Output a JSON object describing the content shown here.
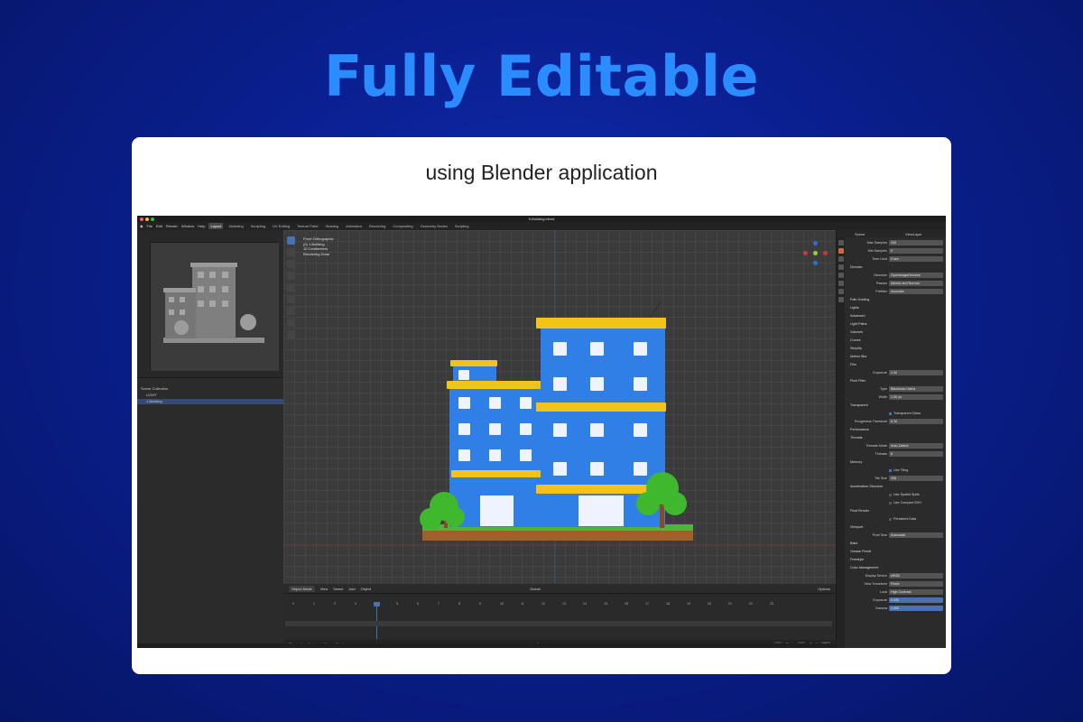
{
  "headline": "Fully Editable",
  "subtitle": "using Blender application",
  "app": {
    "title": "9-Building.blend",
    "traffic_colors": [
      "#ff5f57",
      "#febc2e",
      "#28c840"
    ],
    "menu": [
      "File",
      "Edit",
      "Render",
      "Window",
      "Help"
    ],
    "workspaces": [
      "Layout",
      "Modeling",
      "Sculpting",
      "UV Editing",
      "Texture Paint",
      "Shading",
      "Animation",
      "Rendering",
      "Compositing",
      "Geometry Nodes",
      "Scripting"
    ],
    "active_workspace": "Layout",
    "scene": "Scene",
    "view_layer": "ViewLayer"
  },
  "outliner": {
    "rows": [
      "Scene Collection",
      "LIGHT",
      "1.Building"
    ]
  },
  "viewport": {
    "info": [
      "Front Orthographic",
      "(0) 1.Building",
      "10 Centimeters",
      "Rendering Done"
    ],
    "mode": "Object Mode",
    "menu": [
      "View",
      "Select",
      "Add",
      "Object"
    ],
    "transform": "Global",
    "options": "Options"
  },
  "timeline": {
    "menu": [
      "Playback",
      "Keying",
      "View",
      "Marker"
    ],
    "frames": [
      "0",
      "1",
      "2",
      "3",
      "4",
      "5",
      "6",
      "7",
      "8",
      "9",
      "10",
      "11",
      "12",
      "13",
      "14",
      "15",
      "16",
      "17",
      "18",
      "19",
      "20",
      "21",
      "22",
      "23"
    ],
    "current_frame": "4",
    "start_label": "Start",
    "start": "1",
    "end_label": "End",
    "end": "20"
  },
  "properties": {
    "rows": [
      {
        "label": "Max Samples",
        "value": "200"
      },
      {
        "label": "Min Samples",
        "value": "0"
      },
      {
        "label": "Time Limit",
        "value": "0 sec"
      },
      {
        "section": "Denoise"
      },
      {
        "label": "Denoiser",
        "value": "OpenImageDenoise"
      },
      {
        "label": "Passes",
        "value": "Albedo and Normal"
      },
      {
        "label": "Prefilter",
        "value": "Accurate"
      },
      {
        "section": "Path Guiding"
      },
      {
        "section": "Lights"
      },
      {
        "section": "Advanced"
      },
      {
        "section": "Light Paths"
      },
      {
        "section": "Volumes"
      },
      {
        "section": "Curves"
      },
      {
        "section": "Simplify"
      },
      {
        "section": "Motion Blur"
      },
      {
        "section": "Film"
      },
      {
        "label": "Exposure",
        "value": "1.00"
      },
      {
        "section": "Pixel Filter"
      },
      {
        "label": "Type",
        "value": "Blackman-Harris"
      },
      {
        "label": "Width",
        "value": "1.50 px"
      },
      {
        "section": "Transparent"
      },
      {
        "check": "Transparent Glass"
      },
      {
        "label": "Roughness Threshold",
        "value": "0.10"
      },
      {
        "section": "Performance"
      },
      {
        "section": "Threads"
      },
      {
        "label": "Threads Mode",
        "value": "Auto-Detect"
      },
      {
        "label": "Threads",
        "value": "8"
      },
      {
        "section": "Memory"
      },
      {
        "check": "Use Tiling"
      },
      {
        "label": "Tile Size",
        "value": "256"
      },
      {
        "section": "Acceleration Structure"
      },
      {
        "check_off": "Use Spatial Splits"
      },
      {
        "check_off": "Use Compact BVH"
      },
      {
        "section": "Final Render"
      },
      {
        "check_off": "Persistent Data"
      },
      {
        "section": "Viewport"
      },
      {
        "label": "Pixel Size",
        "value": "Automatic"
      },
      {
        "section": "Bake"
      },
      {
        "section": "Grease Pencil"
      },
      {
        "section": "Freestyle"
      },
      {
        "section": "Color Management"
      },
      {
        "label": "Display Device",
        "value": "sRGB"
      },
      {
        "label": "View Transform",
        "value": "Filmic"
      },
      {
        "label": "Look",
        "value": "High Contrast"
      },
      {
        "label": "Exposure",
        "value": "0.000",
        "blue": true
      },
      {
        "label": "Gamma",
        "value": "1.000",
        "blue": true
      }
    ]
  },
  "colors": {
    "building_blue": "#2f7fe6",
    "building_yellow": "#f2c419",
    "tree_green": "#3fb82e",
    "grass": "#48b838",
    "soil": "#a0602c",
    "selection": "#4772b3"
  }
}
